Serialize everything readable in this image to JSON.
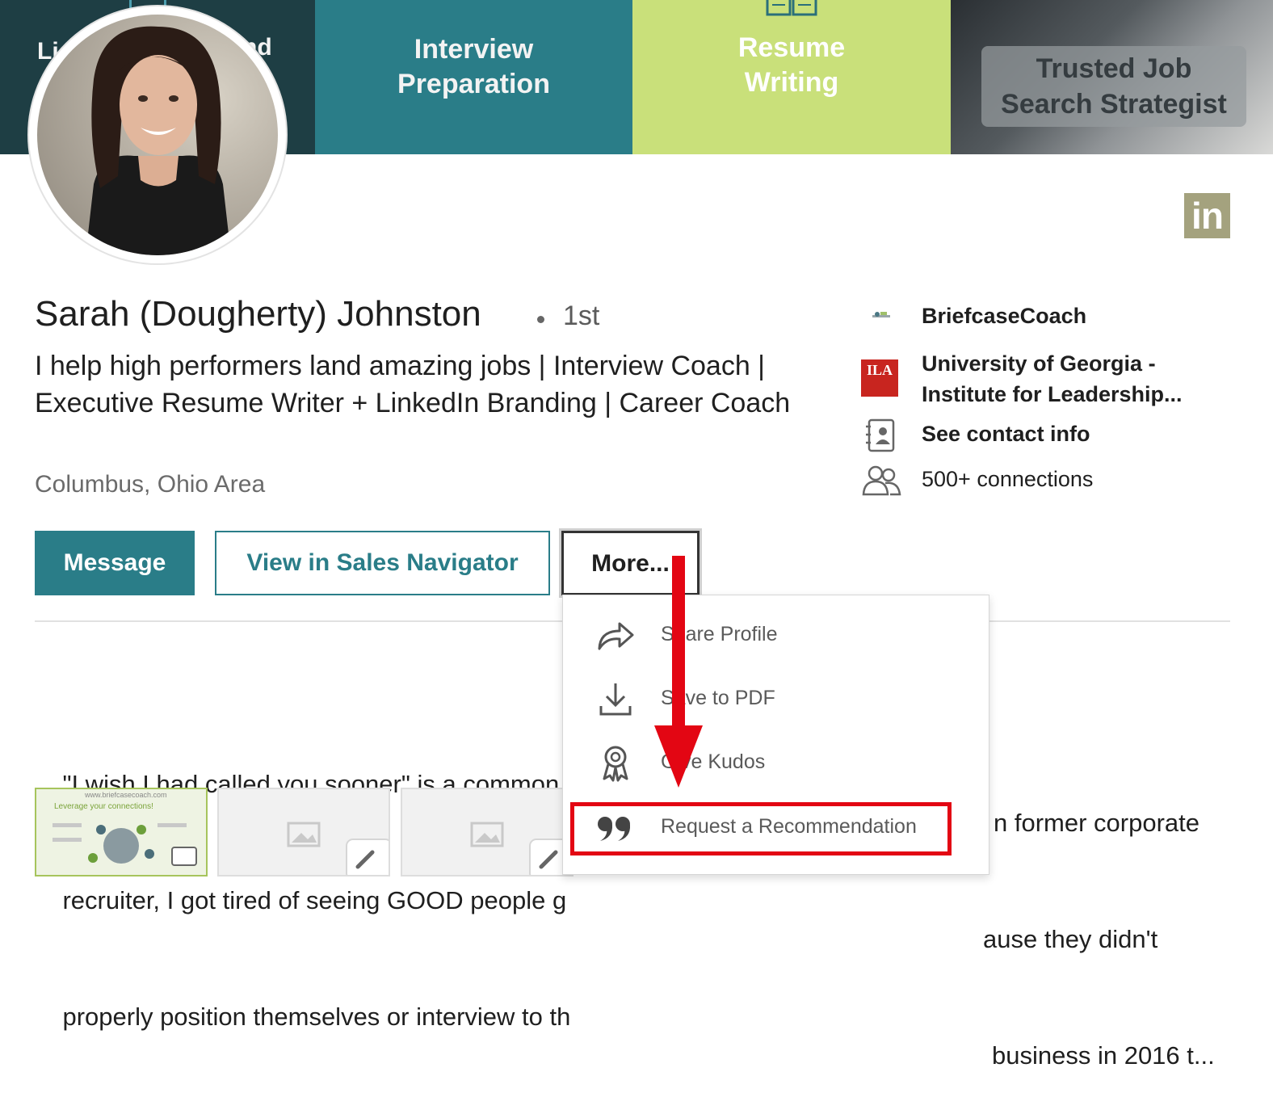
{
  "banner": {
    "panel1_left": "Li",
    "panel1_right": "nd",
    "panel2": "Interview Preparation",
    "panel3": "Resume Writing",
    "panel4": "Trusted Job Search Strategist"
  },
  "profile": {
    "name": "Sarah (Dougherty) Johnston",
    "degree": "1st",
    "headline": "I help high performers land amazing jobs | Interview Coach | Executive Resume Writer + LinkedIn Branding | Career Coach",
    "location": "Columbus, Ohio Area"
  },
  "side": {
    "company": "BriefcaseCoach",
    "school": "University of Georgia - Institute for Leadership...",
    "school_logo": "ILA",
    "contact": "See contact info",
    "connections": "500+ connections"
  },
  "actions": {
    "message": "Message",
    "sales_navigator": "View in Sales Navigator",
    "more": "More..."
  },
  "summary": {
    "line1_left": "\"I wish I had called you sooner\" is a common c",
    "line1_right": "n former corporate",
    "line2_left": "recruiter, I got tired of seeing GOOD people g",
    "line2_right": "ause they didn't",
    "line3_left": "properly position themselves or interview to th",
    "line3_right": "business in 2016 t..."
  },
  "media": {
    "thumb1_caption": "www.briefcasecoach.com",
    "thumb1_title": "Leverage your connections!"
  },
  "menu": {
    "items": [
      {
        "label": "Share Profile",
        "icon": "share-icon"
      },
      {
        "label": "Save to PDF",
        "icon": "download-icon"
      },
      {
        "label": "Give Kudos",
        "icon": "kudos-ribbon-icon"
      },
      {
        "label": "Request a Recommendation",
        "icon": "quote-icon"
      }
    ]
  },
  "logo": "in",
  "colors": {
    "teal": "#2a7d88",
    "lime": "#c9e07a",
    "annotation_red": "#e30613",
    "linkedin_logo": "#a4a27e"
  }
}
